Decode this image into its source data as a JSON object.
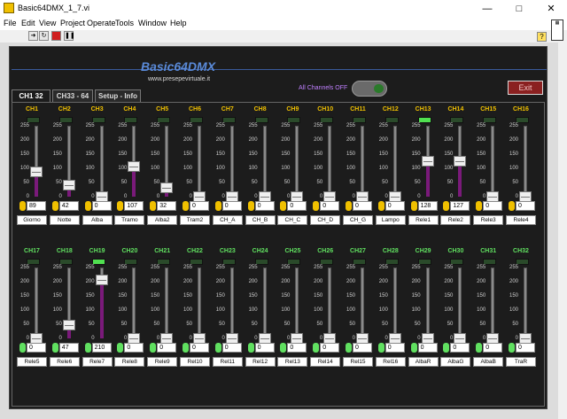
{
  "window": {
    "title": "Basic64DMX_1_7.vi"
  },
  "menu": [
    "File",
    "Edit",
    "View",
    "Project",
    "Operate",
    "Tools",
    "Window",
    "Help"
  ],
  "panel": {
    "app_title": "Basic64DMX",
    "website": "www.presepevirtuale.it",
    "all_channels_label": "All Channels OFF",
    "exit_label": "Exit",
    "tabs": [
      "CH1  32",
      "CH33 - 64",
      "Setup - Info"
    ],
    "scale_ticks": [
      "255",
      "200",
      "150",
      "100",
      "50",
      "0"
    ]
  },
  "channels": [
    {
      "label": "CH1",
      "value": "89",
      "name": "Giorno",
      "led_on": false
    },
    {
      "label": "CH2",
      "value": "42",
      "name": "Notte",
      "led_on": false
    },
    {
      "label": "CH3",
      "value": "0",
      "name": "Alba",
      "led_on": false
    },
    {
      "label": "CH4",
      "value": "107",
      "name": "Tramo",
      "led_on": false
    },
    {
      "label": "CH5",
      "value": "32",
      "name": "Alba2",
      "led_on": false
    },
    {
      "label": "CH6",
      "value": "0",
      "name": "Tram2",
      "led_on": false
    },
    {
      "label": "CH7",
      "value": "0",
      "name": "CH_A",
      "led_on": false
    },
    {
      "label": "CH8",
      "value": "0",
      "name": "CH_B",
      "led_on": false
    },
    {
      "label": "CH9",
      "value": "0",
      "name": "CH_C",
      "led_on": false
    },
    {
      "label": "CH10",
      "value": "0",
      "name": "CH_D",
      "led_on": false
    },
    {
      "label": "CH11",
      "value": "0",
      "name": "CH_G",
      "led_on": false
    },
    {
      "label": "CH12",
      "value": "0",
      "name": "Lampo",
      "led_on": false
    },
    {
      "label": "CH13",
      "value": "128",
      "name": "Rele1",
      "led_on": true
    },
    {
      "label": "CH14",
      "value": "127",
      "name": "Rele2",
      "led_on": false
    },
    {
      "label": "CH15",
      "value": "0",
      "name": "Rele3",
      "led_on": false
    },
    {
      "label": "CH16",
      "value": "0",
      "name": "Rele4",
      "led_on": false
    },
    {
      "label": "CH17",
      "value": "0",
      "name": "Rele5",
      "led_on": false
    },
    {
      "label": "CH18",
      "value": "47",
      "name": "Rele6",
      "led_on": false
    },
    {
      "label": "CH19",
      "value": "210",
      "name": "Rele7",
      "led_on": true
    },
    {
      "label": "CH20",
      "value": "0",
      "name": "Rele8",
      "led_on": false
    },
    {
      "label": "CH21",
      "value": "0",
      "name": "Rele9",
      "led_on": false
    },
    {
      "label": "CH22",
      "value": "0",
      "name": "Rel10",
      "led_on": false
    },
    {
      "label": "CH23",
      "value": "0",
      "name": "Rel11",
      "led_on": false
    },
    {
      "label": "CH24",
      "value": "0",
      "name": "Rel12",
      "led_on": false
    },
    {
      "label": "CH25",
      "value": "0",
      "name": "Rel13",
      "led_on": false
    },
    {
      "label": "CH26",
      "value": "0",
      "name": "Rel14",
      "led_on": false
    },
    {
      "label": "CH27",
      "value": "0",
      "name": "Rel15",
      "led_on": false
    },
    {
      "label": "CH28",
      "value": "0",
      "name": "Rel16",
      "led_on": false
    },
    {
      "label": "CH29",
      "value": "0",
      "name": "AlbaR",
      "led_on": false
    },
    {
      "label": "CH30",
      "value": "0",
      "name": "AlbaG",
      "led_on": false
    },
    {
      "label": "CH31",
      "value": "0",
      "name": "AlbaB",
      "led_on": false
    },
    {
      "label": "CH32",
      "value": "0",
      "name": "TraR",
      "led_on": false
    }
  ]
}
